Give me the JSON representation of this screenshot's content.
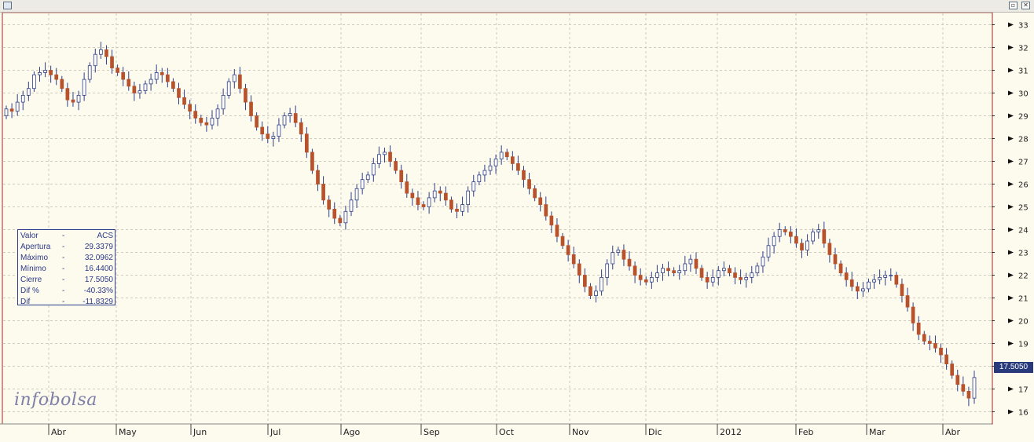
{
  "window": {
    "restore_icon": "restore-icon",
    "close_icon": "close-icon"
  },
  "info_box": {
    "rows": [
      {
        "label": "Valor",
        "dash": "-",
        "value": "ACS"
      },
      {
        "label": "Apertura",
        "dash": "-",
        "value": "29.3379"
      },
      {
        "label": "Máximo",
        "dash": "-",
        "value": "32.0962"
      },
      {
        "label": "Mínimo",
        "dash": "-",
        "value": "16.4400"
      },
      {
        "label": "Cierre",
        "dash": "-",
        "value": "17.5050"
      },
      {
        "label": "Dif %",
        "dash": "-",
        "value": "-40.33%"
      },
      {
        "label": "Dif",
        "dash": "-",
        "value": "-11.8329"
      }
    ]
  },
  "logo": {
    "text": "infobolsa"
  },
  "price_badge": "17.5050",
  "colors": {
    "background": "#fdfaee",
    "bull_candle": "#ffffff",
    "bear_candle": "#b8522c",
    "candle_outline": "#2e3f88",
    "badge": "#283a7c",
    "frame": "#9e2a26"
  },
  "chart_data": {
    "type": "candlestick",
    "title": "",
    "xlabel": "",
    "ylabel": "",
    "ylim": [
      15.5,
      33.5
    ],
    "y_ticks": [
      16,
      17,
      18,
      19,
      20,
      21,
      22,
      23,
      24,
      25,
      26,
      27,
      28,
      29,
      30,
      31,
      32,
      33
    ],
    "x_labels": [
      "Abr",
      "May",
      "Jun",
      "Jul",
      "Ago",
      "Sep",
      "Oct",
      "Nov",
      "Dic",
      "2012",
      "Feb",
      "Mar",
      "Abr"
    ],
    "grid": true,
    "last_close": 17.505,
    "series": [
      {
        "close": [
          29.3,
          29.2,
          29.6,
          29.9,
          30.2,
          30.8,
          30.9,
          31.0,
          30.8,
          30.6,
          30.2,
          29.7,
          29.6,
          29.9,
          30.6,
          31.2,
          31.7,
          31.9,
          31.6,
          31.1,
          30.9,
          30.6,
          30.3,
          30.0,
          30.1,
          30.4,
          30.6,
          30.9,
          30.8,
          30.5,
          30.2,
          29.8,
          29.5,
          29.2,
          28.9,
          28.7,
          28.6,
          28.9,
          29.3,
          29.9,
          30.5,
          30.8,
          30.2,
          29.6,
          29.0,
          28.5,
          28.2,
          28.0,
          28.1,
          28.6,
          29.0,
          29.1,
          28.7,
          28.2,
          27.4,
          26.6,
          26.0,
          25.3,
          24.9,
          24.5,
          24.3,
          24.8,
          25.3,
          25.8,
          26.2,
          26.4,
          26.9,
          27.3,
          27.4,
          27.0,
          26.6,
          26.1,
          25.6,
          25.4,
          25.1,
          25.0,
          25.4,
          25.7,
          25.6,
          25.3,
          24.9,
          24.8,
          25.1,
          25.7,
          26.1,
          26.4,
          26.6,
          26.8,
          27.1,
          27.4,
          27.2,
          26.9,
          26.6,
          26.2,
          25.8,
          25.4,
          25.1,
          24.6,
          24.2,
          23.7,
          23.3,
          22.9,
          22.5,
          22.0,
          21.5,
          21.1,
          21.3,
          21.9,
          22.5,
          23.0,
          23.1,
          22.7,
          22.4,
          22.0,
          21.8,
          21.7,
          21.9,
          22.1,
          22.3,
          22.2,
          22.1,
          22.2,
          22.5,
          22.7,
          22.3,
          21.9,
          21.7,
          21.9,
          22.2,
          22.3,
          22.1,
          21.9,
          21.8,
          21.9,
          22.1,
          22.4,
          22.8,
          23.3,
          23.7,
          24.0,
          23.9,
          23.7,
          23.4,
          23.1,
          23.5,
          23.9,
          24.0,
          23.4,
          22.9,
          22.5,
          22.1,
          21.8,
          21.5,
          21.3,
          21.4,
          21.7,
          21.8,
          21.9,
          22.0,
          22.0,
          21.6,
          21.1,
          20.6,
          19.9,
          19.4,
          19.1,
          19.0,
          18.8,
          18.5,
          18.1,
          17.6,
          17.2,
          16.9,
          16.6,
          17.505
        ],
        "open": [
          29.0,
          29.3,
          29.2,
          29.6,
          29.9,
          30.2,
          30.8,
          30.9,
          31.0,
          30.8,
          30.6,
          30.2,
          29.7,
          29.6,
          29.9,
          30.6,
          31.2,
          31.7,
          31.9,
          31.6,
          31.1,
          30.9,
          30.6,
          30.3,
          30.0,
          30.1,
          30.4,
          30.6,
          30.9,
          30.8,
          30.5,
          30.2,
          29.8,
          29.5,
          29.2,
          28.9,
          28.7,
          28.6,
          28.9,
          29.3,
          29.9,
          30.5,
          30.8,
          30.2,
          29.6,
          29.0,
          28.5,
          28.2,
          28.0,
          28.1,
          28.6,
          29.0,
          29.1,
          28.7,
          28.2,
          27.4,
          26.6,
          26.0,
          25.3,
          24.9,
          24.5,
          24.3,
          24.8,
          25.3,
          25.8,
          26.2,
          26.4,
          26.9,
          27.3,
          27.4,
          27.0,
          26.6,
          26.1,
          25.6,
          25.4,
          25.1,
          25.0,
          25.4,
          25.7,
          25.6,
          25.3,
          24.9,
          24.8,
          25.1,
          25.7,
          26.1,
          26.4,
          26.6,
          26.8,
          27.1,
          27.4,
          27.2,
          26.9,
          26.6,
          26.2,
          25.8,
          25.4,
          25.1,
          24.6,
          24.2,
          23.7,
          23.3,
          22.9,
          22.5,
          22.0,
          21.5,
          21.1,
          21.3,
          21.9,
          22.5,
          23.0,
          23.1,
          22.7,
          22.4,
          22.0,
          21.8,
          21.7,
          21.9,
          22.1,
          22.3,
          22.2,
          22.1,
          22.2,
          22.5,
          22.7,
          22.3,
          21.9,
          21.7,
          21.9,
          22.2,
          22.3,
          22.1,
          21.9,
          21.8,
          21.9,
          22.1,
          22.4,
          22.8,
          23.3,
          23.7,
          24.0,
          23.9,
          23.7,
          23.4,
          23.1,
          23.5,
          23.9,
          24.0,
          23.4,
          22.9,
          22.5,
          22.1,
          21.8,
          21.5,
          21.3,
          21.4,
          21.7,
          21.8,
          21.9,
          22.0,
          22.0,
          21.6,
          21.1,
          20.6,
          19.9,
          19.4,
          19.1,
          19.0,
          18.8,
          18.5,
          18.1,
          17.6,
          17.2,
          16.9,
          16.6
        ]
      }
    ]
  }
}
